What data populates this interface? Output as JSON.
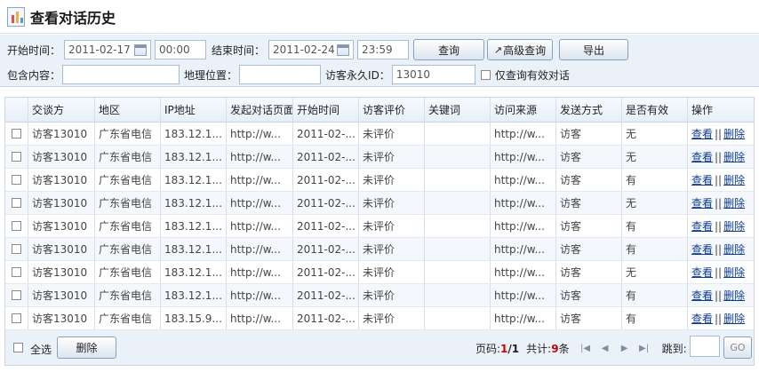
{
  "header": {
    "title": "查看对话历史",
    "icon": "chart-document-icon"
  },
  "filters": {
    "start_label": "开始时间：",
    "start_date": "2011-02-17",
    "start_time": "00:00",
    "end_label": "结束时间：",
    "end_date": "2011-02-24",
    "end_time": "23:59",
    "query_btn": "查询",
    "advanced_btn": "高级查询",
    "export_btn": "导出",
    "content_label": "包含内容：",
    "content_value": "",
    "geo_label": "地理位置：",
    "geo_value": "",
    "visitor_id_label": "访客永久ID：",
    "visitor_id_value": "13010",
    "valid_only_label": "仅查询有效对话"
  },
  "table": {
    "columns": [
      "交谈方",
      "地区",
      "IP地址",
      "发起对话页面",
      "开始时间",
      "访客评价",
      "关键词",
      "访问来源",
      "发送方式",
      "是否有效",
      "操作"
    ],
    "view_label": "查看",
    "delete_label": "删除",
    "rows": [
      {
        "party": "访客13010",
        "region": "广东省电信",
        "ip": "183.12.1...",
        "page": "http://w...",
        "start": "2011-02-...",
        "rating": "未评价",
        "keyword": "",
        "source": "http://w...",
        "method": "访客",
        "valid": "无"
      },
      {
        "party": "访客13010",
        "region": "广东省电信",
        "ip": "183.12.1...",
        "page": "http://w...",
        "start": "2011-02-...",
        "rating": "未评价",
        "keyword": "",
        "source": "http://w...",
        "method": "访客",
        "valid": "无"
      },
      {
        "party": "访客13010",
        "region": "广东省电信",
        "ip": "183.12.1...",
        "page": "http://w...",
        "start": "2011-02-...",
        "rating": "未评价",
        "keyword": "",
        "source": "http://w...",
        "method": "访客",
        "valid": "有"
      },
      {
        "party": "访客13010",
        "region": "广东省电信",
        "ip": "183.12.1...",
        "page": "http://w...",
        "start": "2011-02-...",
        "rating": "未评价",
        "keyword": "",
        "source": "http://w...",
        "method": "访客",
        "valid": "无"
      },
      {
        "party": "访客13010",
        "region": "广东省电信",
        "ip": "183.12.1...",
        "page": "http://w...",
        "start": "2011-02-...",
        "rating": "未评价",
        "keyword": "",
        "source": "http://w...",
        "method": "访客",
        "valid": "有"
      },
      {
        "party": "访客13010",
        "region": "广东省电信",
        "ip": "183.12.1...",
        "page": "http://w...",
        "start": "2011-02-...",
        "rating": "未评价",
        "keyword": "",
        "source": "http://w...",
        "method": "访客",
        "valid": "有"
      },
      {
        "party": "访客13010",
        "region": "广东省电信",
        "ip": "183.12.1...",
        "page": "http://w...",
        "start": "2011-02-...",
        "rating": "未评价",
        "keyword": "",
        "source": "http://w...",
        "method": "访客",
        "valid": "无"
      },
      {
        "party": "访客13010",
        "region": "广东省电信",
        "ip": "183.12.1...",
        "page": "http://w...",
        "start": "2011-02-...",
        "rating": "未评价",
        "keyword": "",
        "source": "http://w...",
        "method": "访客",
        "valid": "有"
      },
      {
        "party": "访客13010",
        "region": "广东省电信",
        "ip": "183.15.9...",
        "page": "http://w...",
        "start": "2011-02-...",
        "rating": "未评价",
        "keyword": "",
        "source": "http://w...",
        "method": "访客",
        "valid": "有"
      }
    ]
  },
  "footer": {
    "select_all_label": "全选",
    "delete_btn": "删除",
    "page_label": "页码:",
    "page_current": "1",
    "page_sep": "/",
    "page_total": "1",
    "total_label": "共计:",
    "total_count": "9",
    "total_unit": "条",
    "jump_label": "跳到:",
    "jump_value": "",
    "go_btn": "GO"
  },
  "colors": {
    "panel_bg": "#eaf1f9",
    "border": "#c7d5e6",
    "highlight": "#cc0000",
    "link": "#0b3d91"
  }
}
